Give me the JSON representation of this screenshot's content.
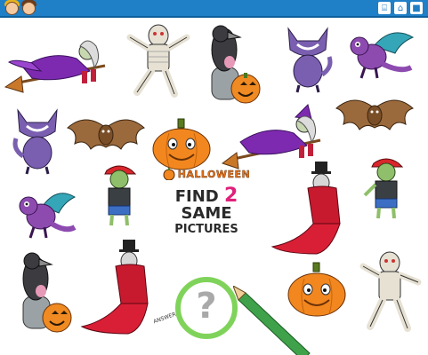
{
  "puzzle": {
    "brand": "HALLOWEEN",
    "find_word": "FIND",
    "count": "2",
    "same_word": "SAME",
    "pictures_word": "PICTURES",
    "hint_symbol": "?",
    "answer_label": "ANSWER"
  },
  "toolbar": {
    "icon_a": "⌸",
    "icon_b": "⌂",
    "icon_c": "■"
  },
  "pictures": [
    {
      "name": "witch",
      "count": 2
    },
    {
      "name": "mummy",
      "count": 2
    },
    {
      "name": "raven-on-tombstone",
      "count": 2
    },
    {
      "name": "cat",
      "count": 2
    },
    {
      "name": "dragon",
      "count": 2
    },
    {
      "name": "bat",
      "count": 2
    },
    {
      "name": "pumpkin",
      "count": 3
    },
    {
      "name": "zombie-boy",
      "count": 2
    },
    {
      "name": "vampire",
      "count": 2
    }
  ]
}
